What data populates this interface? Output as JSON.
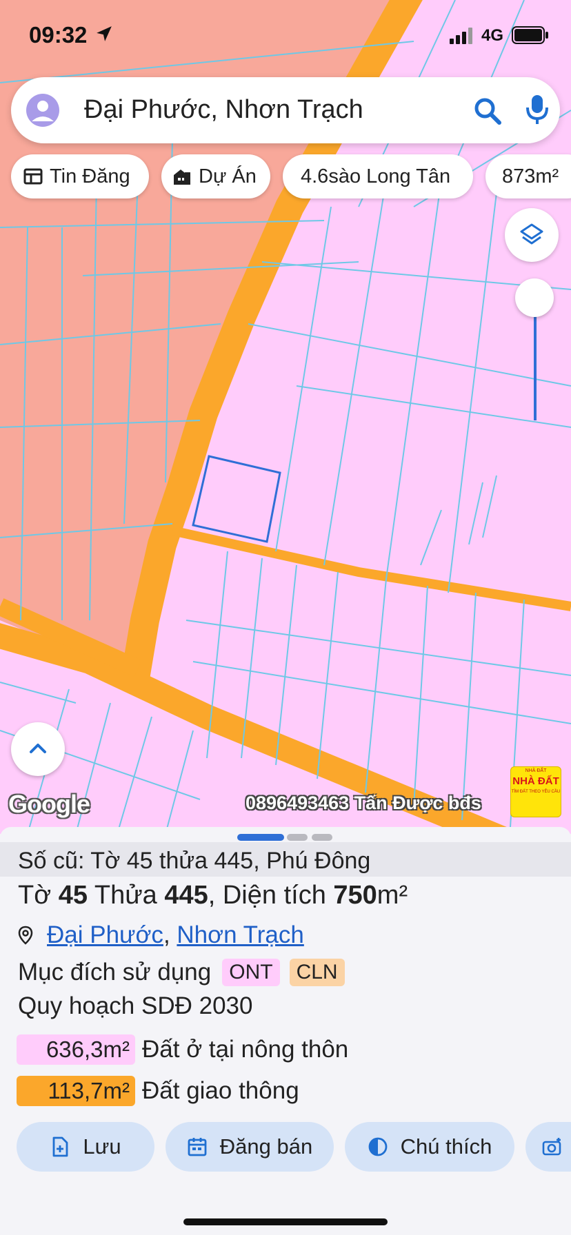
{
  "status_bar": {
    "time": "09:32",
    "network": "4G"
  },
  "search": {
    "query": "Đại Phước, Nhơn Trạch"
  },
  "chips": [
    {
      "label": "Tin Đăng",
      "icon": "listing-icon"
    },
    {
      "label": "Dự Án",
      "icon": "building-icon"
    },
    {
      "label": "4.6sào Long Tân"
    },
    {
      "label": "873m²"
    }
  ],
  "map": {
    "attribution": "Google",
    "watermark": "0896493463 Tấn Được bđs",
    "ad": {
      "top": "NHÀ ĐẤT",
      "title": "NHÀ ĐẤT",
      "sub": "TÌM ĐẤT THEO YÊU CẦU"
    },
    "colors": {
      "residential": "#ffccfb",
      "commercial": "#f8a89a",
      "road": "#fba72b",
      "boundary": "#6ec8e6",
      "selected": "#2f6fd6"
    }
  },
  "parcel": {
    "old_id": "Số cũ: Tờ 45 thửa 445, Phú Đông",
    "title_prefix": "Tờ ",
    "sheet_no": "45",
    "title_mid": " Thửa ",
    "parcel_no": "445",
    "title_area_label": ", Diện tích ",
    "area": "750",
    "area_unit": "m²",
    "location_1": "Đại Phước",
    "location_sep": ", ",
    "location_2": "Nhơn Trạch",
    "purpose_label": "Mục đích sử dụng",
    "purpose_tags": [
      "ONT",
      "CLN"
    ],
    "plan_label": "Quy hoạch SDĐ 2030",
    "plan_areas": [
      {
        "value": "636,3m²",
        "label": "Đất ở tại nông thôn",
        "color": "#ffccfb"
      },
      {
        "value": "113,7m²",
        "label": "Đất giao thông",
        "color": "#fba72b"
      }
    ]
  },
  "actions": [
    {
      "label": "Lưu",
      "icon": "save-icon"
    },
    {
      "label": "Đăng bán",
      "icon": "calendar-icon"
    },
    {
      "label": "Chú thích",
      "icon": "contrast-icon"
    },
    {
      "label": "",
      "icon": "camera-icon"
    }
  ]
}
